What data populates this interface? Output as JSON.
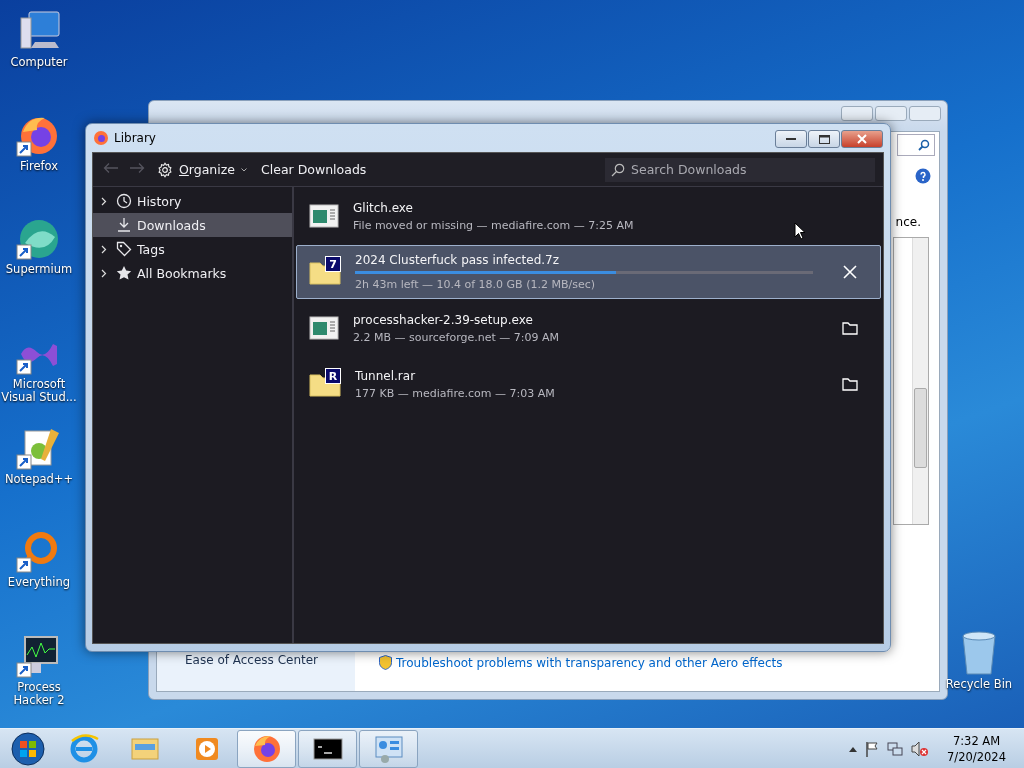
{
  "desktop_icons": [
    {
      "label": "Computer",
      "shortcut": false
    },
    {
      "label": "Firefox",
      "shortcut": true
    },
    {
      "label": "Supermium",
      "shortcut": true
    },
    {
      "label": "Microsoft Visual Stud...",
      "shortcut": true
    },
    {
      "label": "Notepad++",
      "shortcut": true
    },
    {
      "label": "Everything",
      "shortcut": true
    },
    {
      "label": "Process Hacker 2",
      "shortcut": true
    }
  ],
  "recycle_bin": {
    "label": "Recycle Bin"
  },
  "background_window": {
    "text_fragment": "nce.",
    "nav_link": "Ease of Access Center",
    "link": "Troubleshoot problems with transparency and other Aero effects"
  },
  "library": {
    "title": "Library",
    "toolbar": {
      "organize": "Organize",
      "clear": "Clear Downloads",
      "search_placeholder": "Search Downloads"
    },
    "sidebar": [
      {
        "label": "History",
        "expandable": true,
        "selected": false
      },
      {
        "label": "Downloads",
        "expandable": false,
        "selected": true
      },
      {
        "label": "Tags",
        "expandable": true,
        "selected": false
      },
      {
        "label": "All Bookmarks",
        "expandable": true,
        "selected": false
      }
    ],
    "downloads": [
      {
        "name": "Glitch.exe",
        "status": "File moved or missing — mediafire.com — 7:25 AM",
        "kind": "program",
        "selected": false,
        "cancelable": false,
        "folder_button": false
      },
      {
        "name": "2024 Clusterfuck pass infected.7z",
        "status": "2h 43m left — 10.4 of 18.0 GB (1.2 MB/sec)",
        "kind": "archive",
        "badge": "7",
        "selected": true,
        "level": 0.57,
        "cancelable": true,
        "folder_button": false
      },
      {
        "name": "processhacker-2.39-setup.exe",
        "status": "2.2 MB — sourceforge.net — 7:09 AM",
        "kind": "program",
        "selected": false,
        "cancelable": false,
        "folder_button": true
      },
      {
        "name": "Tunnel.rar",
        "status": "177 KB — mediafire.com — 7:03 AM",
        "kind": "archive",
        "badge": "R",
        "selected": false,
        "cancelable": false,
        "folder_button": true
      }
    ]
  },
  "taskbar": {
    "apps": [
      {
        "running": false,
        "active": false
      },
      {
        "running": false,
        "active": false
      },
      {
        "running": false,
        "active": false
      },
      {
        "running": true,
        "active": true
      },
      {
        "running": true,
        "active": false
      },
      {
        "running": true,
        "active": false
      }
    ],
    "clock": {
      "time": "7:32 AM",
      "date": "7/20/2024"
    }
  }
}
